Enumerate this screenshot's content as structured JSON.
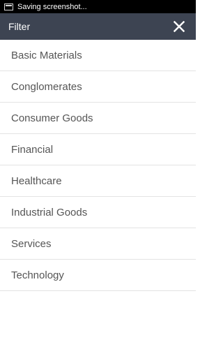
{
  "status": {
    "notification_text": "Saving screenshot...",
    "icon": "screenshot-icon"
  },
  "app_bar": {
    "title": "Filter",
    "close_icon": "close-icon",
    "background": "#3d4452"
  },
  "sectors": [
    {
      "label": "Basic Materials"
    },
    {
      "label": "Conglomerates"
    },
    {
      "label": "Consumer Goods"
    },
    {
      "label": "Financial"
    },
    {
      "label": "Healthcare"
    },
    {
      "label": "Industrial Goods"
    },
    {
      "label": "Services"
    },
    {
      "label": "Technology"
    }
  ]
}
